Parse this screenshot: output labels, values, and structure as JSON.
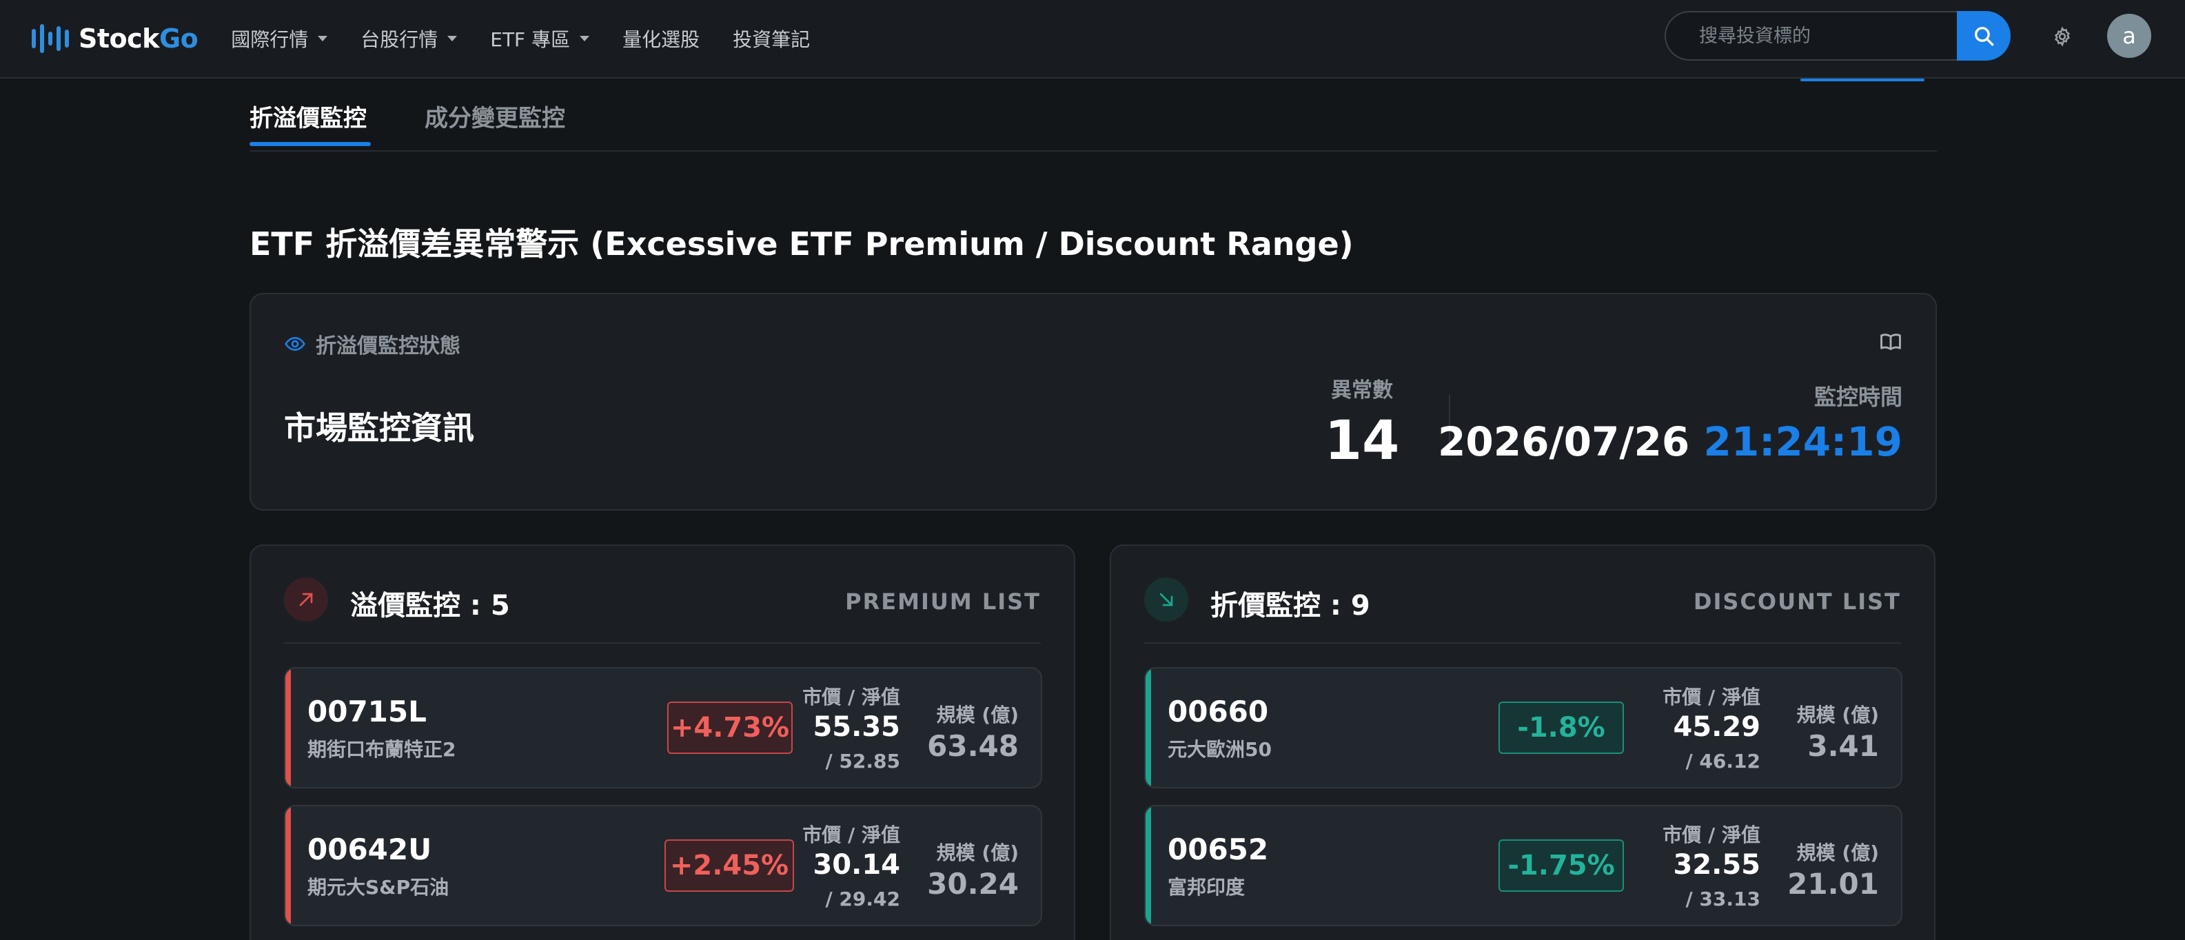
{
  "navbar": {
    "brand": {
      "part1": "Stock",
      "part2": "Go"
    },
    "menu": [
      {
        "label": "國際行情",
        "dropdown": true
      },
      {
        "label": "台股行情",
        "dropdown": true
      },
      {
        "label": "ETF 專區",
        "dropdown": true
      },
      {
        "label": "量化選股",
        "dropdown": false
      },
      {
        "label": "投資筆記",
        "dropdown": false
      }
    ],
    "search_placeholder": "搜尋投資標的",
    "avatar_letter": "a"
  },
  "tabs": [
    {
      "label": "折溢價監控",
      "active": true
    },
    {
      "label": "成分變更監控",
      "active": false
    }
  ],
  "section_title": "ETF 折溢價差異常警示 (Excessive ETF Premium / Discount Range)",
  "status": {
    "heading": "折溢價監控狀態",
    "name": "市場監控資訊",
    "count_label": "異常數",
    "count": "14",
    "time_label": "監控時間",
    "date": "2026/07/26",
    "time": "21:24:19"
  },
  "premium": {
    "title": "溢價監控 : 5",
    "tag": "PREMIUM LIST",
    "rows": [
      {
        "code": "00715L",
        "name": "期街口布蘭特正2",
        "pct": "+4.73%",
        "price_label": "市價 / 淨值",
        "price": "55.35",
        "nav": "/ 52.85",
        "size_label": "規模 (億)",
        "size": "63.48"
      },
      {
        "code": "00642U",
        "name": "期元大S&P石油",
        "pct": "+2.45%",
        "price_label": "市價 / 淨值",
        "price": "30.14",
        "nav": "/ 29.42",
        "size_label": "規模 (億)",
        "size": "30.24"
      }
    ]
  },
  "discount": {
    "title": "折價監控 : 9",
    "tag": "DISCOUNT LIST",
    "rows": [
      {
        "code": "00660",
        "name": "元大歐洲50",
        "pct": "-1.8%",
        "price_label": "市價 / 淨值",
        "price": "45.29",
        "nav": "/ 46.12",
        "size_label": "規模 (億)",
        "size": "3.41"
      },
      {
        "code": "00652",
        "name": "富邦印度",
        "pct": "-1.75%",
        "price_label": "市價 / 淨值",
        "price": "32.55",
        "nav": "/ 33.13",
        "size_label": "規模 (億)",
        "size": "21.01"
      }
    ]
  },
  "colors": {
    "accent": "#1a7fe6",
    "premium": "#e0504d",
    "discount": "#1aa68e",
    "background": "#131619",
    "card": "#1b1f24"
  }
}
